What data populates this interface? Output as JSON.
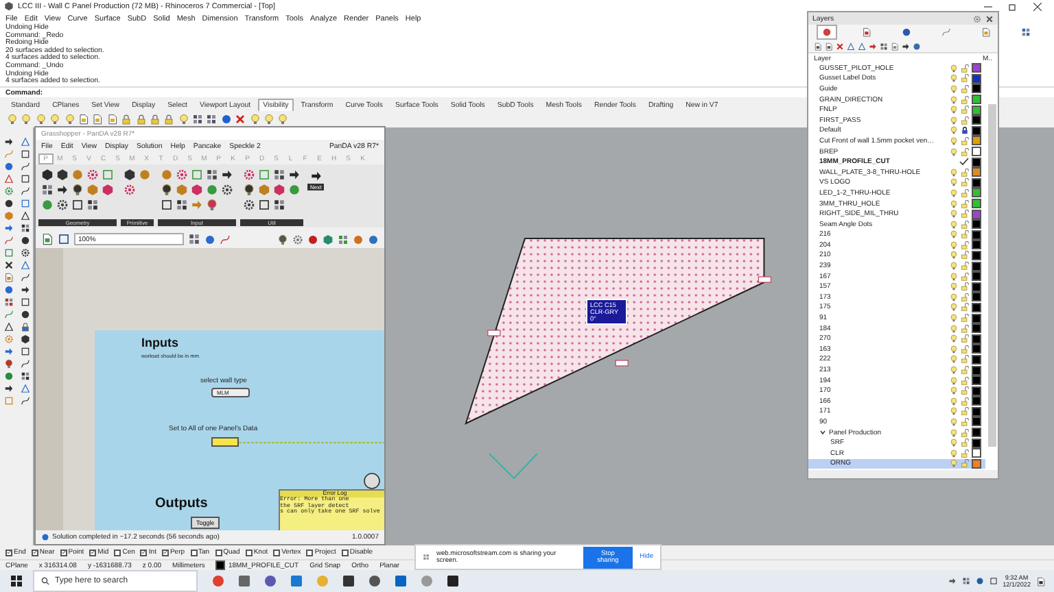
{
  "window": {
    "title": "LCC III - Wall C Panel Production (72 MB) - Rhinoceros 7 Commercial - [Top]"
  },
  "menu": [
    "File",
    "Edit",
    "View",
    "Curve",
    "Surface",
    "SubD",
    "Solid",
    "Mesh",
    "Dimension",
    "Transform",
    "Tools",
    "Analyze",
    "Render",
    "Panels",
    "Help"
  ],
  "command_history": [
    "Undoing Hide",
    "Command: _Redo",
    "Redoing Hide",
    "20 surfaces added to selection.",
    "4 surfaces added to selection.",
    "Command: _Undo",
    "Undoing Hide",
    "4 surfaces added to selection."
  ],
  "command_prompt": "Command:",
  "toolbar_tabs": [
    {
      "label": "Standard",
      "selected": false
    },
    {
      "label": "CPlanes",
      "selected": false
    },
    {
      "label": "Set View",
      "selected": false
    },
    {
      "label": "Display",
      "selected": false
    },
    {
      "label": "Select",
      "selected": false
    },
    {
      "label": "Viewport Layout",
      "selected": false
    },
    {
      "label": "Visibility",
      "selected": true
    },
    {
      "label": "Transform",
      "selected": false
    },
    {
      "label": "Curve Tools",
      "selected": false
    },
    {
      "label": "Surface Tools",
      "selected": false
    },
    {
      "label": "Solid Tools",
      "selected": false
    },
    {
      "label": "SubD Tools",
      "selected": false
    },
    {
      "label": "Mesh Tools",
      "selected": false
    },
    {
      "label": "Render Tools",
      "selected": false
    },
    {
      "label": "Drafting",
      "selected": false
    },
    {
      "label": "New in V7",
      "selected": false
    }
  ],
  "viewport": {
    "object_tag": [
      "LCC C15",
      "CLR-GRY",
      "0°"
    ]
  },
  "grasshopper": {
    "title": "Grasshopper - PanDA v28 R7*",
    "menu": [
      "File",
      "Edit",
      "View",
      "Display",
      "Solution",
      "Help",
      "Pancake",
      "Speckle 2"
    ],
    "document": "PanDA v28 R7*",
    "component_tabs": [
      {
        "label": "P",
        "selected": true
      },
      {
        "label": "M",
        "selected": false
      },
      {
        "label": "S",
        "selected": false
      },
      {
        "label": "V",
        "selected": false
      },
      {
        "label": "C",
        "selected": false
      },
      {
        "label": "S",
        "selected": false
      },
      {
        "label": "M",
        "selected": false
      },
      {
        "label": "X",
        "selected": false
      },
      {
        "label": "T",
        "selected": false
      },
      {
        "label": "D",
        "selected": false
      },
      {
        "label": "S",
        "selected": false
      },
      {
        "label": "M",
        "selected": false
      },
      {
        "label": "P",
        "selected": false
      },
      {
        "label": "K",
        "selected": false
      },
      {
        "label": "P",
        "selected": false
      },
      {
        "label": "D",
        "selected": false
      },
      {
        "label": "S",
        "selected": false
      },
      {
        "label": "L",
        "selected": false
      },
      {
        "label": "F",
        "selected": false
      },
      {
        "label": "E",
        "selected": false
      },
      {
        "label": "H",
        "selected": false
      },
      {
        "label": "S",
        "selected": false
      },
      {
        "label": "K",
        "selected": false
      }
    ],
    "ribbon_groups": [
      "Geometry",
      "Primitive",
      "Input",
      "Util"
    ],
    "next_label": "Next",
    "zoom": "100%",
    "canvas": {
      "inputs_heading": "Inputs",
      "inputs_note": "workset should be in mm",
      "wall_type_label": "select wall type",
      "wall_type_value": "MLM",
      "set_all_label": "Set to All of one Panel's Data",
      "outputs_heading": "Outputs",
      "toggle_label": "Toggle",
      "error_log": {
        "title": "Error Log",
        "lines": [
          "Error: More than one",
          "the SRF layer detect",
          "s can only take one SRF solve"
        ]
      }
    },
    "status": "Solution completed in ~17.2 seconds (56 seconds ago)",
    "version": "1.0.0007"
  },
  "layers": {
    "title": "Layers",
    "tabs": [
      {
        "selected": true
      },
      {
        "selected": false
      },
      {
        "selected": false
      },
      {
        "selected": false
      },
      {
        "selected": false
      },
      {
        "selected": false
      }
    ],
    "header": {
      "name": "Layer",
      "material": "M.."
    },
    "items": [
      {
        "name": "GUSSET_PILOT_HOLE",
        "color": "#a040d0",
        "locked": false,
        "current": false,
        "selected": false
      },
      {
        "name": "Gusset Label Dots",
        "color": "#1030c0",
        "locked": false,
        "current": false,
        "selected": false
      },
      {
        "name": "Guide",
        "color": "#000000",
        "locked": false,
        "current": false,
        "selected": false
      },
      {
        "name": "GRAIN_DIRECTION",
        "color": "#30c030",
        "locked": false,
        "current": false,
        "selected": false
      },
      {
        "name": "FNLP",
        "color": "#30c030",
        "locked": false,
        "current": false,
        "selected": false
      },
      {
        "name": "FIRST_PASS",
        "color": "#000000",
        "locked": false,
        "current": false,
        "selected": false
      },
      {
        "name": "Default",
        "color": "#000000",
        "locked": true,
        "current": false,
        "selected": false
      },
      {
        "name": "Cut Front of wall 1.5mm pocket ven…",
        "color": "#e0a000",
        "locked": false,
        "current": false,
        "selected": false
      },
      {
        "name": "BREP",
        "color": "#ffffff",
        "locked": false,
        "current": false,
        "selected": false
      },
      {
        "name": "18MM_PROFILE_CUT",
        "color": "#000000",
        "current": true,
        "selected": false
      },
      {
        "name": "WALL_PLATE_3-8_THRU-HOLE",
        "color": "#e08a20",
        "locked": false,
        "current": false,
        "selected": false
      },
      {
        "name": "VS LOGO",
        "color": "#000000",
        "locked": false,
        "current": false,
        "selected": false
      },
      {
        "name": "LED_1-2_THRU-HOLE",
        "color": "#30c030",
        "locked": false,
        "current": false,
        "selected": false
      },
      {
        "name": "3MM_THRU_HOLE",
        "color": "#30c030",
        "locked": false,
        "current": false,
        "selected": false
      },
      {
        "name": "RIGHT_SIDE_MIL_THRU",
        "color": "#a040d0",
        "locked": false,
        "current": false,
        "selected": false
      },
      {
        "name": "Seam Angle Dots",
        "color": "#000000",
        "locked": false,
        "current": false,
        "selected": false
      },
      {
        "name": "216",
        "color": "#000000",
        "locked": false,
        "current": false,
        "selected": false
      },
      {
        "name": "204",
        "color": "#000000",
        "locked": false,
        "current": false,
        "selected": false
      },
      {
        "name": "210",
        "color": "#000000",
        "locked": false,
        "current": false,
        "selected": false
      },
      {
        "name": "239",
        "color": "#000000",
        "locked": false,
        "current": false,
        "selected": false
      },
      {
        "name": "167",
        "color": "#000000",
        "locked": false,
        "current": false,
        "selected": false
      },
      {
        "name": "157",
        "color": "#000000",
        "locked": false,
        "current": false,
        "selected": false
      },
      {
        "name": "173",
        "color": "#000000",
        "locked": false,
        "current": false,
        "selected": false
      },
      {
        "name": "175",
        "color": "#000000",
        "locked": false,
        "current": false,
        "selected": false
      },
      {
        "name": "91",
        "color": "#000000",
        "locked": false,
        "current": false,
        "selected": false
      },
      {
        "name": "184",
        "color": "#000000",
        "locked": false,
        "current": false,
        "selected": false
      },
      {
        "name": "270",
        "color": "#000000",
        "locked": false,
        "current": false,
        "selected": false
      },
      {
        "name": "163",
        "color": "#000000",
        "locked": false,
        "current": false,
        "selected": false
      },
      {
        "name": "222",
        "color": "#000000",
        "locked": false,
        "current": false,
        "selected": false
      },
      {
        "name": "213",
        "color": "#000000",
        "locked": false,
        "current": false,
        "selected": false
      },
      {
        "name": "194",
        "color": "#000000",
        "locked": false,
        "current": false,
        "selected": false
      },
      {
        "name": "170",
        "color": "#000000",
        "locked": false,
        "current": false,
        "selected": false
      },
      {
        "name": "166",
        "color": "#000000",
        "locked": false,
        "current": false,
        "selected": false
      },
      {
        "name": "171",
        "color": "#000000",
        "locked": false,
        "current": false,
        "selected": false
      },
      {
        "name": "90",
        "color": "#000000",
        "locked": false,
        "current": false,
        "selected": false
      },
      {
        "name": "Panel Production",
        "color": "#000000",
        "locked": false,
        "current": false,
        "selected": false,
        "expanded": true,
        "children": [
          {
            "name": "SRF",
            "color": "#000000",
            "locked": false,
            "current": false,
            "selected": false
          },
          {
            "name": "CLR",
            "color": "#ffffff",
            "locked": false,
            "current": false,
            "selected": false
          },
          {
            "name": "ORNG",
            "color": "#f08020",
            "locked": false,
            "current": false,
            "selected": true
          }
        ]
      }
    ]
  },
  "osnaps": [
    {
      "label": "End",
      "checked": true
    },
    {
      "label": "Near",
      "checked": true
    },
    {
      "label": "Point",
      "checked": true
    },
    {
      "label": "Mid",
      "checked": true
    },
    {
      "label": "Cen",
      "checked": false
    },
    {
      "label": "Int",
      "checked": true
    },
    {
      "label": "Perp",
      "checked": true
    },
    {
      "label": "Tan",
      "checked": false
    },
    {
      "label": "Quad",
      "checked": false
    },
    {
      "label": "Knot",
      "checked": false
    },
    {
      "label": "Vertex",
      "checked": false
    },
    {
      "label": "Project",
      "checked": false
    },
    {
      "label": "Disable",
      "checked": false
    }
  ],
  "status_bar": {
    "cplane": "CPlane",
    "x": "x 316314.08",
    "y": "y -1631688.73",
    "z": "z 0.00",
    "units": "Millimeters",
    "layer": "18MM_PROFILE_CUT",
    "toggles": [
      "Grid Snap",
      "Ortho",
      "Planar"
    ]
  },
  "share_bar": {
    "message": "web.microsoftstream.com is sharing your screen.",
    "stop": "Stop sharing",
    "hide": "Hide"
  },
  "taskbar": {
    "search_placeholder": "Type here to search",
    "time": "9:32 AM",
    "date": "12/1/2022"
  }
}
